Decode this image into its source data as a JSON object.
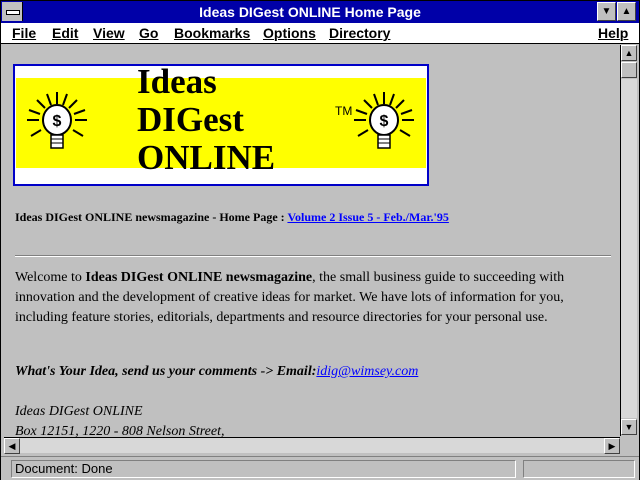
{
  "window": {
    "title": "Ideas DIGest ONLINE Home Page"
  },
  "menu": {
    "file": "File",
    "edit": "Edit",
    "view": "View",
    "go": "Go",
    "bookmarks": "Bookmarks",
    "options": "Options",
    "directory": "Directory",
    "help": "Help"
  },
  "logo": {
    "line1": "Ideas",
    "line2": "DIGest",
    "line3": "ONLINE",
    "tm": "TM"
  },
  "headline": {
    "prefix": "Ideas DIGest ONLINE newsmagazine - Home Page : ",
    "link": "Volume 2 Issue 5 - Feb./Mar.'95"
  },
  "welcome": {
    "intro": "Welcome to ",
    "bold": "Ideas DIGest ONLINE newsmagazine",
    "rest": ", the small business guide to succeeding with innovation and the development of creative ideas for market. We have lots of information for you, including feature stories, editorials, departments and resource directories for your personal use."
  },
  "comments": {
    "prompt": "What's Your Idea, send us your comments -> Email:",
    "email": "idig@wimsey.com"
  },
  "address": {
    "line1": "Ideas DIGest ONLINE",
    "line2": "Box 12151, 1220 - 808 Nelson Street,"
  },
  "status": {
    "text": "Document: Done"
  },
  "icons": {
    "system": "system-menu-icon",
    "minimize": "minimize-icon",
    "maximize": "maximize-icon",
    "bulb": "lightbulb-dollar-icon"
  },
  "colors": {
    "titlebar": "#0000a8",
    "link": "#0000ff",
    "logo_bg": "#ffff00",
    "logo_border": "#0000c8"
  }
}
